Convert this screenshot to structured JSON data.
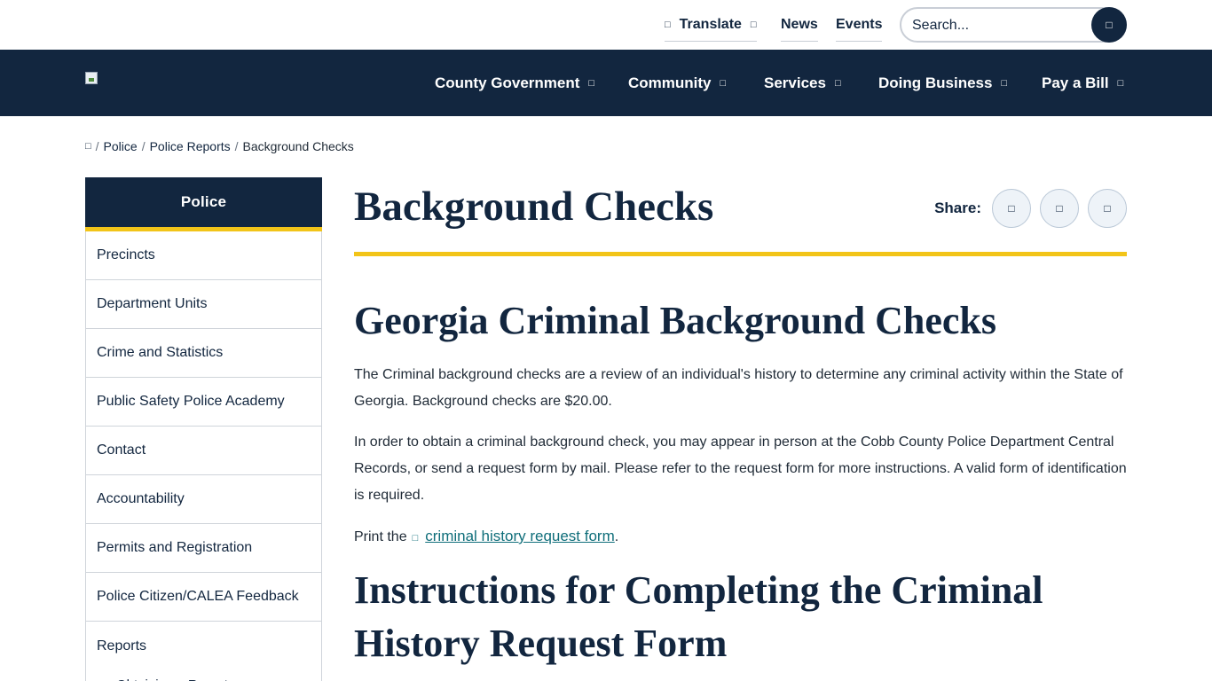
{
  "utility": {
    "translate": {
      "icon": "globe-icon",
      "label": "Translate",
      "caret": "chevron-down-icon"
    },
    "news": "News",
    "events": "Events",
    "search_placeholder": "Search...",
    "search_icon": "search-icon"
  },
  "nav": {
    "items": [
      {
        "label": "County Government"
      },
      {
        "label": "Community"
      },
      {
        "label": "Services"
      },
      {
        "label": "Doing Business"
      },
      {
        "label": "Pay a Bill"
      }
    ]
  },
  "breadcrumb": {
    "home_icon": "home-icon",
    "items": [
      "Police",
      "Police Reports",
      "Background Checks"
    ],
    "separator": "/"
  },
  "sidebar": {
    "title": "Police",
    "items": [
      {
        "label": "Precincts"
      },
      {
        "label": "Department Units"
      },
      {
        "label": "Crime and Statistics"
      },
      {
        "label": "Public Safety Police Academy"
      },
      {
        "label": "Contact"
      },
      {
        "label": "Accountability"
      },
      {
        "label": "Permits and Registration"
      },
      {
        "label": "Police Citizen/CALEA Feedback"
      },
      {
        "label": "Reports"
      }
    ],
    "subitem": "Obtaining a Report"
  },
  "content": {
    "title": "Background Checks",
    "share_label": "Share:",
    "share_icons": [
      "facebook-icon",
      "twitter-icon",
      "email-icon"
    ],
    "h2_1": "Georgia Criminal Background Checks",
    "p1": "The Criminal background checks are a review of an individual's history to determine any criminal activity within the State of Georgia. Background checks are $20.00.",
    "p2": "In order to obtain a criminal background check, you may appear in person at the Cobb County Police Department Central Records, or send a request form by mail. Please refer to the request form for more instructions. A valid form of identification is required.",
    "p3_prefix": "Print the",
    "p3_link": "criminal history request form",
    "p3_suffix": ".",
    "h2_2": "Instructions for Completing the Criminal History Request Form"
  },
  "colors": {
    "navy": "#12263f",
    "gold": "#f2c418",
    "link": "#0f6e7a"
  }
}
